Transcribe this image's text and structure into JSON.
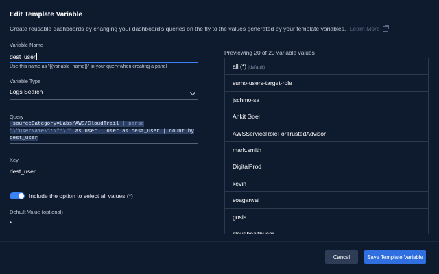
{
  "dialog": {
    "title": "Edit Template Variable",
    "description": "Create reusable dashboards by changing your dashboard's queries on the fly to the values generated by your template variables.",
    "learn_more": "Learn More"
  },
  "form": {
    "variable_name": {
      "label": "Variable Name",
      "value": "dest_user",
      "hint": "Use this name as \"{{variable_name}}\" in your query when creating a panel"
    },
    "variable_type": {
      "label": "Variable Type",
      "value": "Logs Search"
    },
    "query": {
      "label": "Query",
      "line1_a": "_sourceCategory=Labs/AWS/CloudTrail",
      "line1_b": "| parse",
      "line2_a": "\"\\\"userName\\\":\\\"*\\\"\"",
      "line2_b": "as user | user",
      "line2_c": "as dest_user | count by",
      "line3": "dest_user"
    },
    "key": {
      "label": "Key",
      "value": "dest_user"
    },
    "select_all_toggle": {
      "label": "Include the option to select all values (*)",
      "on": true
    },
    "default_value": {
      "label": "Default Value (optional)",
      "value": "*"
    }
  },
  "preview": {
    "label": "Previewing 20 of 20 variable values",
    "items": [
      {
        "value": "all (*)",
        "note": "(default)"
      },
      {
        "value": "sumo-users-target-role",
        "note": ""
      },
      {
        "value": "jschmo-sa",
        "note": ""
      },
      {
        "value": "Ankit Goel",
        "note": ""
      },
      {
        "value": "AWSServiceRoleForTrustedAdvisor",
        "note": ""
      },
      {
        "value": "mark.smith",
        "note": ""
      },
      {
        "value": "DigitalProd",
        "note": ""
      },
      {
        "value": "kevin",
        "note": ""
      },
      {
        "value": "soagarwal",
        "note": ""
      },
      {
        "value": "gosia",
        "note": ""
      },
      {
        "value": "cloudhealthuser",
        "note": ""
      }
    ]
  },
  "buttons": {
    "cancel": "Cancel",
    "save": "Save Template Variable"
  },
  "colors": {
    "accent": "#2f6fe0",
    "background": "#0e1a2e"
  }
}
